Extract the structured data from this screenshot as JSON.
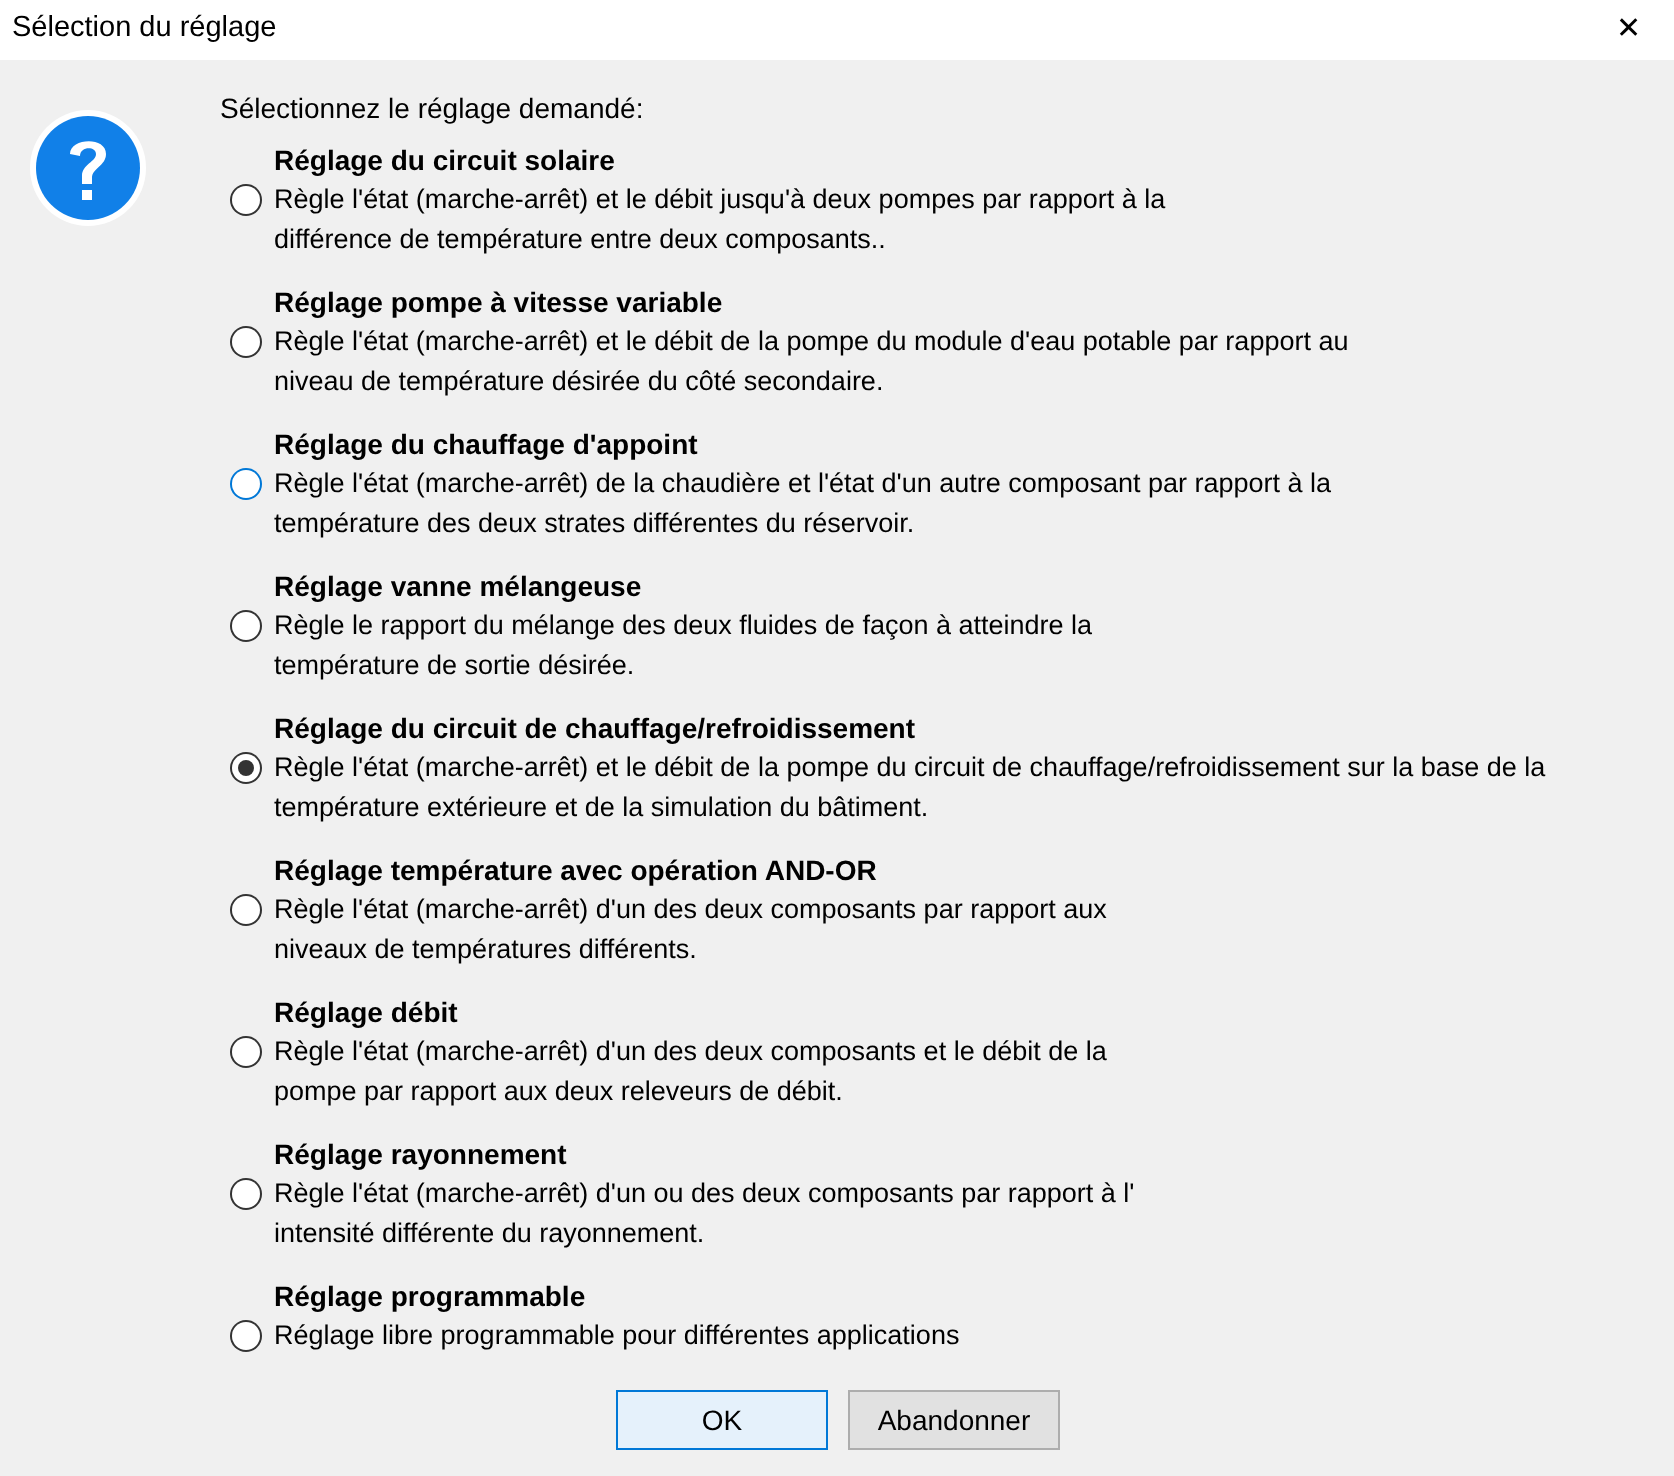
{
  "window": {
    "title": "Sélection du réglage",
    "close": "✕"
  },
  "prompt": "Sélectionnez le réglage demandé:",
  "options": [
    {
      "title": "Réglage du circuit solaire",
      "description": "Règle l'état (marche-arrêt) et le débit jusqu'à deux pompes par rapport à la\ndifférence de température entre deux composants..",
      "selected": false,
      "focused": false
    },
    {
      "title": "Réglage pompe à vitesse variable",
      "description": "Règle l'état (marche-arrêt) et le débit de la pompe du module d'eau potable par rapport au\nniveau de température désirée du côté secondaire.",
      "selected": false,
      "focused": false
    },
    {
      "title": "Réglage du chauffage d'appoint",
      "description": "Règle l'état (marche-arrêt) de la chaudière et l'état d'un autre composant par rapport à la\ntempérature des deux strates différentes du réservoir.",
      "selected": false,
      "focused": true
    },
    {
      "title": "Réglage vanne mélangeuse",
      "description": "Règle le rapport du mélange des deux fluides de façon à atteindre la\ntempérature de sortie désirée.",
      "selected": false,
      "focused": false
    },
    {
      "title": "Réglage du circuit de chauffage/refroidissement",
      "description": "Règle l'état (marche-arrêt) et le débit de la pompe du circuit de chauffage/refroidissement sur la base de la\ntempérature extérieure et de la simulation du bâtiment.",
      "selected": true,
      "focused": false
    },
    {
      "title": "Réglage température avec opération AND-OR",
      "description": "Règle l'état (marche-arrêt) d'un des deux composants par rapport aux\nniveaux de températures différents.",
      "selected": false,
      "focused": false
    },
    {
      "title": "Réglage débit",
      "description": "Règle l'état (marche-arrêt) d'un des deux composants et le débit de la\npompe par rapport aux deux releveurs de débit.",
      "selected": false,
      "focused": false
    },
    {
      "title": "Réglage rayonnement",
      "description": "Règle l'état (marche-arrêt) d'un ou des deux composants par rapport à l'\nintensité différente du rayonnement.",
      "selected": false,
      "focused": false
    },
    {
      "title": "Réglage programmable",
      "description": "Réglage libre programmable pour différentes applications",
      "selected": false,
      "focused": false
    }
  ],
  "buttons": [
    {
      "label": "OK",
      "default": true
    },
    {
      "label": "Abandonner",
      "default": false
    }
  ]
}
